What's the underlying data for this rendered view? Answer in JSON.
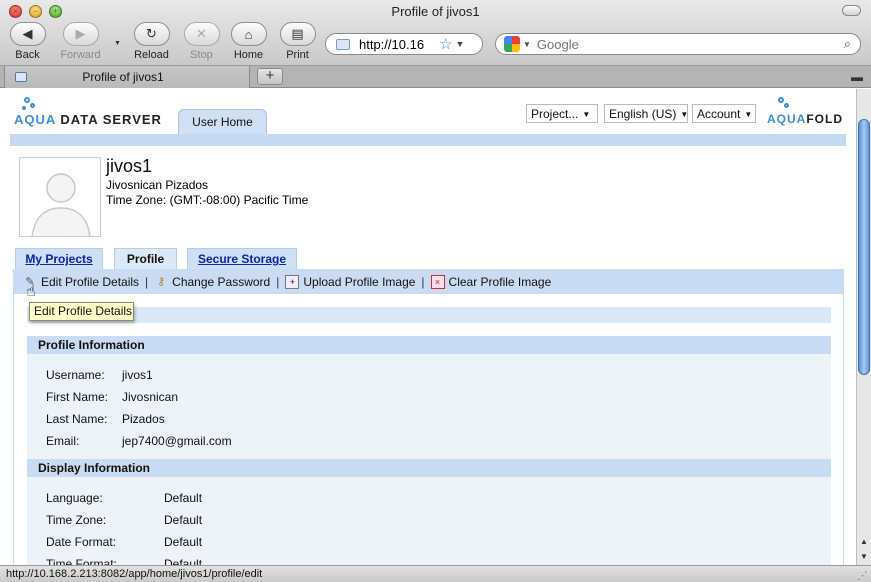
{
  "window": {
    "title": "Profile of jivos1"
  },
  "toolbar": {
    "back": "Back",
    "forward": "Forward",
    "reload": "Reload",
    "stop": "Stop",
    "home": "Home",
    "print": "Print"
  },
  "address": {
    "url": "http://10.16"
  },
  "search": {
    "placeholder": "Google"
  },
  "tab": {
    "label": "Profile of jivos1",
    "new_tab": "+"
  },
  "header": {
    "logo_left_aqua": "AQUA",
    "logo_left_rest": " DATA SERVER",
    "user_home_tab": "User Home",
    "project_select": "Project...",
    "language_select": "English (US)",
    "account_select": "Account",
    "logo_right_aqua": "AQUA",
    "logo_right_rest": "FOLD"
  },
  "profile": {
    "username": "jivos1",
    "full_name": "Jivosnican Pizados",
    "time_zone_line": "Time Zone: (GMT:-08:00) Pacific Time"
  },
  "tabs": [
    {
      "label": "My Projects"
    },
    {
      "label": "Profile"
    },
    {
      "label": "Secure Storage"
    }
  ],
  "actions": [
    {
      "label": "Edit Profile Details",
      "icon": "pencil-icon"
    },
    {
      "label": "Change Password",
      "icon": "key-icon"
    },
    {
      "label": "Upload Profile Image",
      "icon": "upload-image-icon"
    },
    {
      "label": "Clear Profile Image",
      "icon": "clear-image-icon"
    }
  ],
  "tooltip": "Edit Profile Details",
  "sections": {
    "profile_info": {
      "title": "Profile Information",
      "fields": [
        {
          "label": "Username:",
          "value": "jivos1"
        },
        {
          "label": "First Name:",
          "value": "Jivosnican"
        },
        {
          "label": "Last Name:",
          "value": "Pizados"
        },
        {
          "label": "Email:",
          "value": "jep7400@gmail.com"
        }
      ]
    },
    "display_info": {
      "title": "Display Information",
      "fields": [
        {
          "label": "Language:",
          "value": "Default"
        },
        {
          "label": "Time Zone:",
          "value": "Default"
        },
        {
          "label": "Date Format:",
          "value": "Default"
        },
        {
          "label": "Time Format:",
          "value": "Default"
        }
      ]
    }
  },
  "status_bar": {
    "text": "http://10.168.2.213:8082/app/home/jivos1/profile/edit"
  },
  "colors": {
    "accent_blue": "#c9dcf3",
    "link_blue": "#0b23a8",
    "tooltip_bg": "#ffffc8",
    "logo_blue": "#3f8fcf"
  }
}
